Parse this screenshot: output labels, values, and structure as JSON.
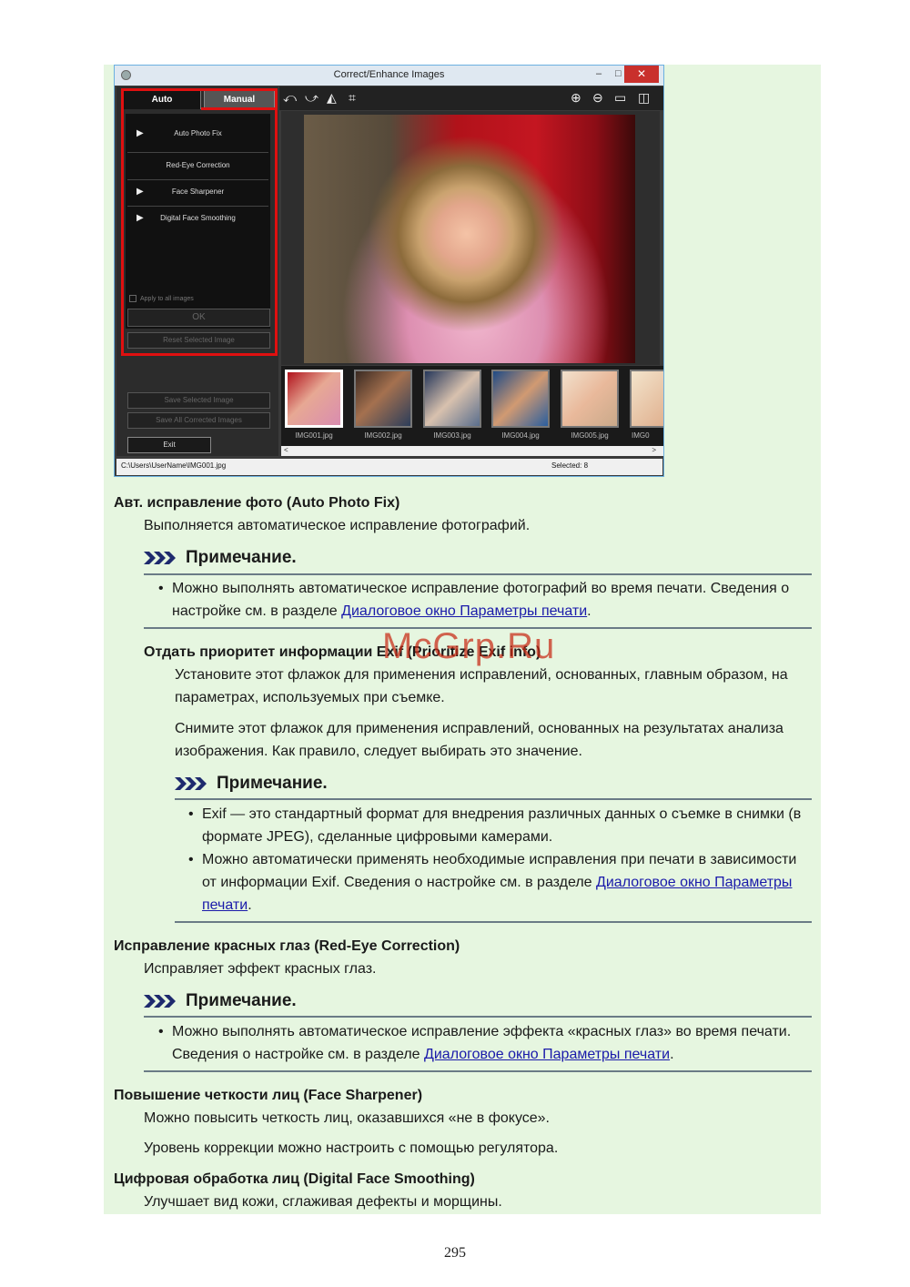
{
  "window": {
    "title": "Correct/Enhance Images",
    "min_glyph": "–",
    "max_glyph": "□",
    "close_glyph": "✕",
    "tabs": [
      "Auto",
      "Manual"
    ],
    "functions": [
      "Auto Photo Fix",
      "Red-Eye Correction",
      "Face Sharpener",
      "Digital Face Smoothing"
    ],
    "apply_label": "Apply to all images",
    "ok_label": "OK",
    "reset_label": "Reset Selected Image",
    "save_selected_label": "Save Selected Image",
    "save_all_label": "Save All Corrected Images",
    "exit_label": "Exit",
    "thumbnails": [
      "IMG001.jpg",
      "IMG002.jpg",
      "IMG003.jpg",
      "IMG004.jpg",
      "IMG005.jpg",
      "IMG0"
    ],
    "status_path": "C:\\Users\\UserName\\IMG001.jpg",
    "status_selected": "Selected: 8",
    "scroll_left": "<",
    "scroll_right": ">"
  },
  "sections": {
    "s1": {
      "title": "Авт. исправление фото (Auto Photo Fix)",
      "desc": "Выполняется автоматическое исправление фотографий."
    },
    "note_label": "Примечание.",
    "n1": {
      "text": "Можно выполнять автоматическое исправление фотографий во время печати. Сведения о настройке см. в разделе ",
      "link": "Диалоговое окно Параметры печати",
      "tail": "."
    },
    "s2": {
      "title": "Отдать приоритет информации Exif (Prioritize Exif info)",
      "p1": "Установите этот флажок для применения исправлений, основанных, главным образом, на параметрах, используемых при съемке.",
      "p2": "Снимите этот флажок для применения исправлений, основанных на результатах анализа изображения. Как правило, следует выбирать это значение."
    },
    "n2": {
      "b1": "Exif — это стандартный формат для внедрения различных данных о съемке в снимки (в формате JPEG), сделанные цифровыми камерами.",
      "b2": "Можно автоматически применять необходимые исправления при печати в зависимости от информации Exif. Сведения о настройке см. в разделе ",
      "b2_link": "Диалоговое окно Параметры печати",
      "b2_tail": "."
    },
    "s3": {
      "title": "Исправление красных глаз (Red-Eye Correction)",
      "desc": "Исправляет эффект красных глаз."
    },
    "n3": {
      "text": "Можно выполнять автоматическое исправление эффекта «красных глаз» во время печати. Сведения о настройке см. в разделе ",
      "link": "Диалоговое окно Параметры печати",
      "tail": "."
    },
    "s4": {
      "title": "Повышение четкости лиц (Face Sharpener)",
      "p1": "Можно повысить четкость лиц, оказавшихся «не в фокусе».",
      "p2": "Уровень коррекции можно настроить с помощью регулятора."
    },
    "s5": {
      "title": "Цифровая обработка лиц (Digital Face Smoothing)",
      "desc": "Улучшает вид кожи, сглаживая дефекты и морщины."
    }
  },
  "bullet_glyph": "•",
  "watermark": "McGrp.Ru",
  "page_number": "295"
}
